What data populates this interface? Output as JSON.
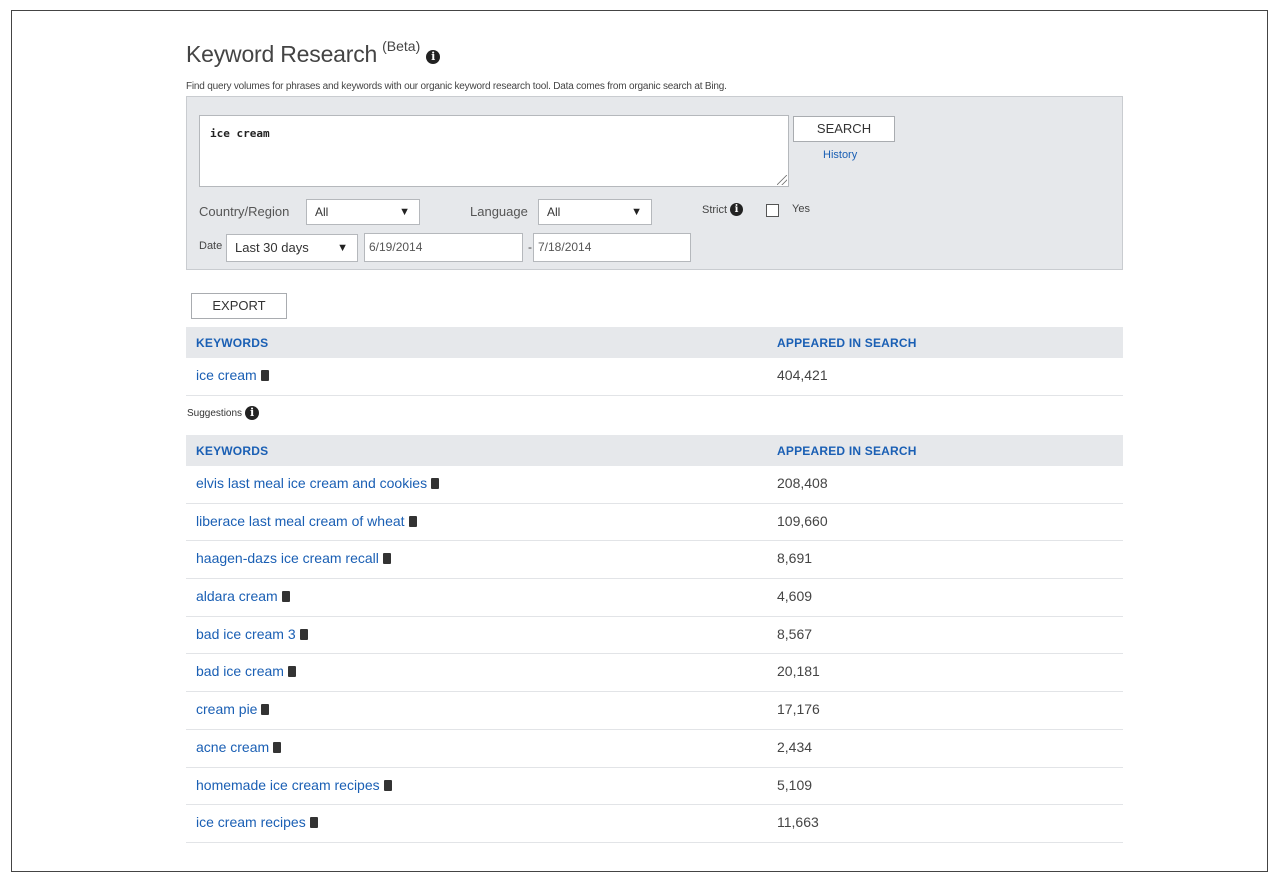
{
  "page": {
    "title": "Keyword Research",
    "beta": "(Beta)",
    "description": "Find query volumes for phrases and keywords with our organic keyword research tool. Data comes from organic search at Bing."
  },
  "search": {
    "query": "ice cream",
    "button": "SEARCH",
    "history": "History",
    "country_label": "Country/Region",
    "country_value": "All",
    "language_label": "Language",
    "language_value": "All",
    "strict_label": "Strict",
    "strict_option": "Yes",
    "date_label": "Date",
    "date_range": "Last 30 days",
    "date_from": "6/19/2014",
    "date_dash": "-",
    "date_to": "7/18/2014"
  },
  "export_label": "EXPORT",
  "main_table": {
    "headers": [
      "KEYWORDS",
      "APPEARED IN SEARCH"
    ],
    "rows": [
      {
        "keyword": "ice cream",
        "count": "404,421"
      }
    ]
  },
  "suggestions_label": "Suggestions",
  "suggestions_table": {
    "headers": [
      "KEYWORDS",
      "APPEARED IN SEARCH"
    ],
    "rows": [
      {
        "keyword": "elvis last meal ice cream and cookies",
        "count": "208,408"
      },
      {
        "keyword": "liberace last meal cream of wheat",
        "count": "109,660"
      },
      {
        "keyword": "haagen-dazs ice cream recall",
        "count": "8,691"
      },
      {
        "keyword": "aldara cream",
        "count": "4,609"
      },
      {
        "keyword": "bad ice cream 3",
        "count": "8,567"
      },
      {
        "keyword": "bad ice cream",
        "count": "20,181"
      },
      {
        "keyword": "cream pie",
        "count": "17,176"
      },
      {
        "keyword": "acne cream",
        "count": "2,434"
      },
      {
        "keyword": "homemade ice cream recipes",
        "count": "5,109"
      },
      {
        "keyword": "ice cream recipes",
        "count": "11,663"
      }
    ]
  },
  "colors": {
    "link": "#1a5fb4",
    "panel": "#e6e8eb"
  }
}
